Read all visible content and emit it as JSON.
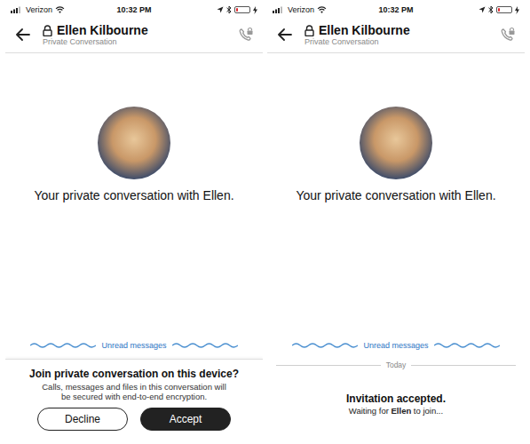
{
  "screens": [
    {
      "status_bar": {
        "carrier": "Verizon",
        "time": "10:32 PM",
        "battery_level": 0.15
      },
      "header": {
        "title": "Ellen Kilbourne",
        "subtitle": "Private Conversation"
      },
      "intro": "Your private conversation with Ellen.",
      "divider": "Unread messages",
      "footer": {
        "kind": "prompt",
        "title": "Join private conversation on this device?",
        "text": "Calls, messages and files in this conversation will be secured with end-to-end encryption.",
        "buttons": [
          {
            "label": "Decline",
            "primary": false
          },
          {
            "label": "Accept",
            "primary": true
          }
        ]
      }
    },
    {
      "status_bar": {
        "carrier": "Verizon",
        "time": "10:32 PM",
        "battery_level": 0.15
      },
      "header": {
        "title": "Ellen Kilbourne",
        "subtitle": "Private Conversation"
      },
      "intro": "Your private conversation with Ellen.",
      "divider": "Unread messages",
      "footer": {
        "kind": "status",
        "date": "Today",
        "title": "Invitation accepted.",
        "parts": [
          {
            "text": "Waiting for ",
            "bold": false
          },
          {
            "text": "Ellen",
            "bold": true
          },
          {
            "text": " to join...",
            "bold": false
          }
        ]
      }
    }
  ]
}
